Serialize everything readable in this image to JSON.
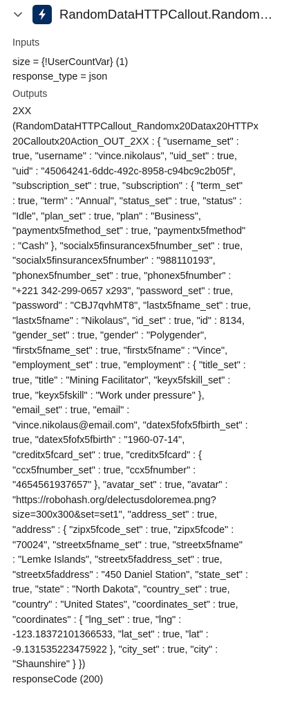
{
  "header": {
    "title": "RandomDataHTTPCallout.Random ...",
    "expand_icon": "chevron-down-icon",
    "app_icon": "lightning-bolt-icon",
    "app_icon_color": "#032d60"
  },
  "inputs": {
    "label": "Inputs",
    "items": [
      "size = {!UserCountVar} (1)",
      "response_type = json"
    ]
  },
  "outputs": {
    "label": "Outputs",
    "value": "2XX\n(RandomDataHTTPCallout_Randomx20Datax20HTTPx\n20Calloutx20Action_OUT_2XX : { \"username_set\" :\ntrue, \"username\" : \"vince.nikolaus\", \"uid_set\" : true,\n\"uid\" : \"45064241-6ddc-492c-8958-c94bc9c2b05f\",\n\"subscription_set\" : true, \"subscription\" : { \"term_set\"\n: true, \"term\" : \"Annual\", \"status_set\" : true, \"status\" :\n\"Idle\", \"plan_set\" : true, \"plan\" : \"Business\",\n\"paymentx5fmethod_set\" : true, \"paymentx5fmethod\"\n: \"Cash\" }, \"socialx5finsurancex5fnumber_set\" : true,\n\"socialx5finsurancex5fnumber\" : \"988110193\",\n\"phonex5fnumber_set\" : true, \"phonex5fnumber\" :\n\"+221 342-299-0657 x293\", \"password_set\" : true,\n\"password\" : \"CBJ7qvhMT8\", \"lastx5fname_set\" : true,\n\"lastx5fname\" : \"Nikolaus\", \"id_set\" : true, \"id\" : 8134,\n\"gender_set\" : true, \"gender\" : \"Polygender\",\n\"firstx5fname_set\" : true, \"firstx5fname\" : \"Vince\",\n\"employment_set\" : true, \"employment\" : { \"title_set\" :\ntrue, \"title\" : \"Mining Facilitator\", \"keyx5fskill_set\" :\ntrue, \"keyx5fskill\" : \"Work under pressure\" },\n\"email_set\" : true, \"email\" :\n\"vince.nikolaus@email.com\", \"datex5fofx5fbirth_set\" :\ntrue, \"datex5fofx5fbirth\" : \"1960-07-14\",\n\"creditx5fcard_set\" : true, \"creditx5fcard\" : {\n\"ccx5fnumber_set\" : true, \"ccx5fnumber\" :\n\"4654561937657\" }, \"avatar_set\" : true, \"avatar\" :\n\"https://robohash.org/delectusdoloremea.png?\nsize=300x300&set=set1\", \"address_set\" : true,\n\"address\" : { \"zipx5fcode_set\" : true, \"zipx5fcode\" :\n\"70024\", \"streetx5fname_set\" : true, \"streetx5fname\"\n: \"Lemke Islands\", \"streetx5faddress_set\" : true,\n\"streetx5faddress\" : \"450 Daniel Station\", \"state_set\" :\ntrue, \"state\" : \"North Dakota\", \"country_set\" : true,\n\"country\" : \"United States\", \"coordinates_set\" : true,\n\"coordinates\" : { \"lng_set\" : true, \"lng\" :\n-123.18372101366533, \"lat_set\" : true, \"lat\" :\n-9.131535223475922 }, \"city_set\" : true, \"city\" :\n\"Shaunshire\" } })",
    "response_code": "responseCode (200)"
  }
}
